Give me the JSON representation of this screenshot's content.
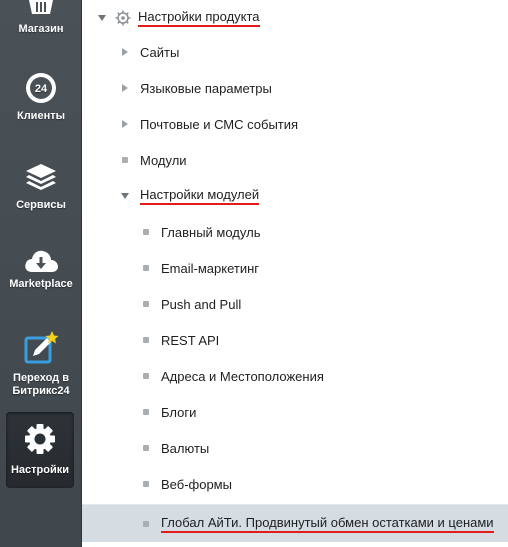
{
  "sidebar": {
    "items": [
      {
        "label": "Магазин",
        "icon": "basket-icon"
      },
      {
        "label": "Клиенты",
        "icon": "clock-24-icon"
      },
      {
        "label": "Сервисы",
        "icon": "layers-icon"
      },
      {
        "label": "Marketplace",
        "icon": "cloud-download-icon"
      },
      {
        "label_line1": "Переход в",
        "label_line2": "Битрикс24",
        "icon": "edit-star-icon"
      },
      {
        "label": "Настройки",
        "icon": "gear-icon"
      }
    ]
  },
  "tree": {
    "root": "Настройки продукта",
    "items": [
      "Сайты",
      "Языковые параметры",
      "Почтовые и СМС события",
      "Модули",
      "Настройки модулей"
    ],
    "modules": [
      "Главный модуль",
      "Email-маркетинг",
      "Push and Pull",
      "REST API",
      "Адреса и Местоположения",
      "Блоги",
      "Валюты",
      "Веб-формы",
      "Глобал АйТи. Продвинутый обмен остатками и ценами"
    ]
  },
  "colors": {
    "sidebar": "#434a50",
    "highlight": "#d5dde2",
    "underline": "#e21b1b"
  }
}
